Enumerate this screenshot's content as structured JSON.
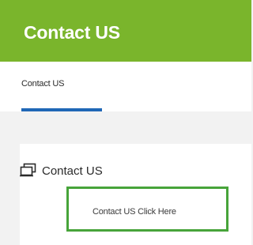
{
  "header": {
    "title": "Contact US"
  },
  "tabs": [
    {
      "label": "Contact US",
      "active": true
    }
  ],
  "card": {
    "heading": "Contact US",
    "icon": "monitor-icon",
    "link_label": "Contact US Click Here"
  },
  "colors": {
    "header_bg": "#7ab52c",
    "tab_indicator": "#1f67b6",
    "highlight_border": "#47a43a",
    "page_bg": "#f2f2f2"
  }
}
